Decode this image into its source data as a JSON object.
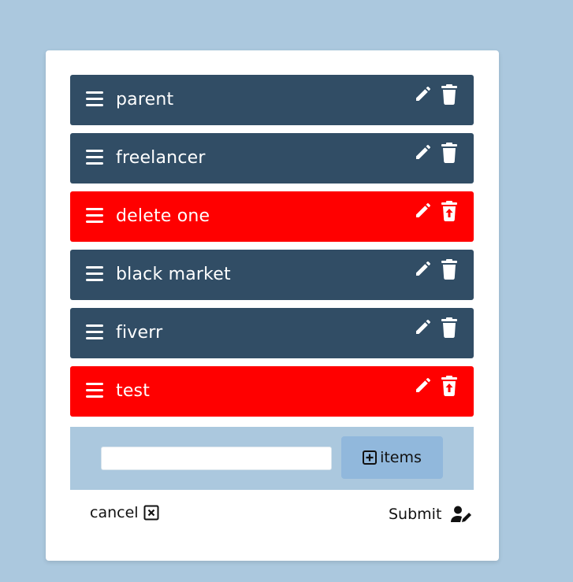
{
  "items": [
    {
      "label": "parent",
      "state": "normal"
    },
    {
      "label": "freelancer",
      "state": "normal"
    },
    {
      "label": "delete one",
      "state": "deleted"
    },
    {
      "label": "black market",
      "state": "normal"
    },
    {
      "label": "fiverr",
      "state": "normal"
    },
    {
      "label": "test",
      "state": "deleted"
    }
  ],
  "add_item": {
    "input_value": "",
    "button_label": "items"
  },
  "footer": {
    "cancel_label": "cancel",
    "submit_label": "Submit"
  },
  "colors": {
    "background": "#abc8de",
    "row": "#314d65",
    "row_deleted": "#ff0000",
    "add_button": "#91b8dc"
  },
  "icons": {
    "handle": "bars-icon",
    "edit": "pencil-icon",
    "delete": "trash-icon",
    "restore": "trash-restore-icon",
    "add": "plus-square-icon",
    "cancel": "close-square-icon",
    "submit": "user-edit-icon"
  }
}
